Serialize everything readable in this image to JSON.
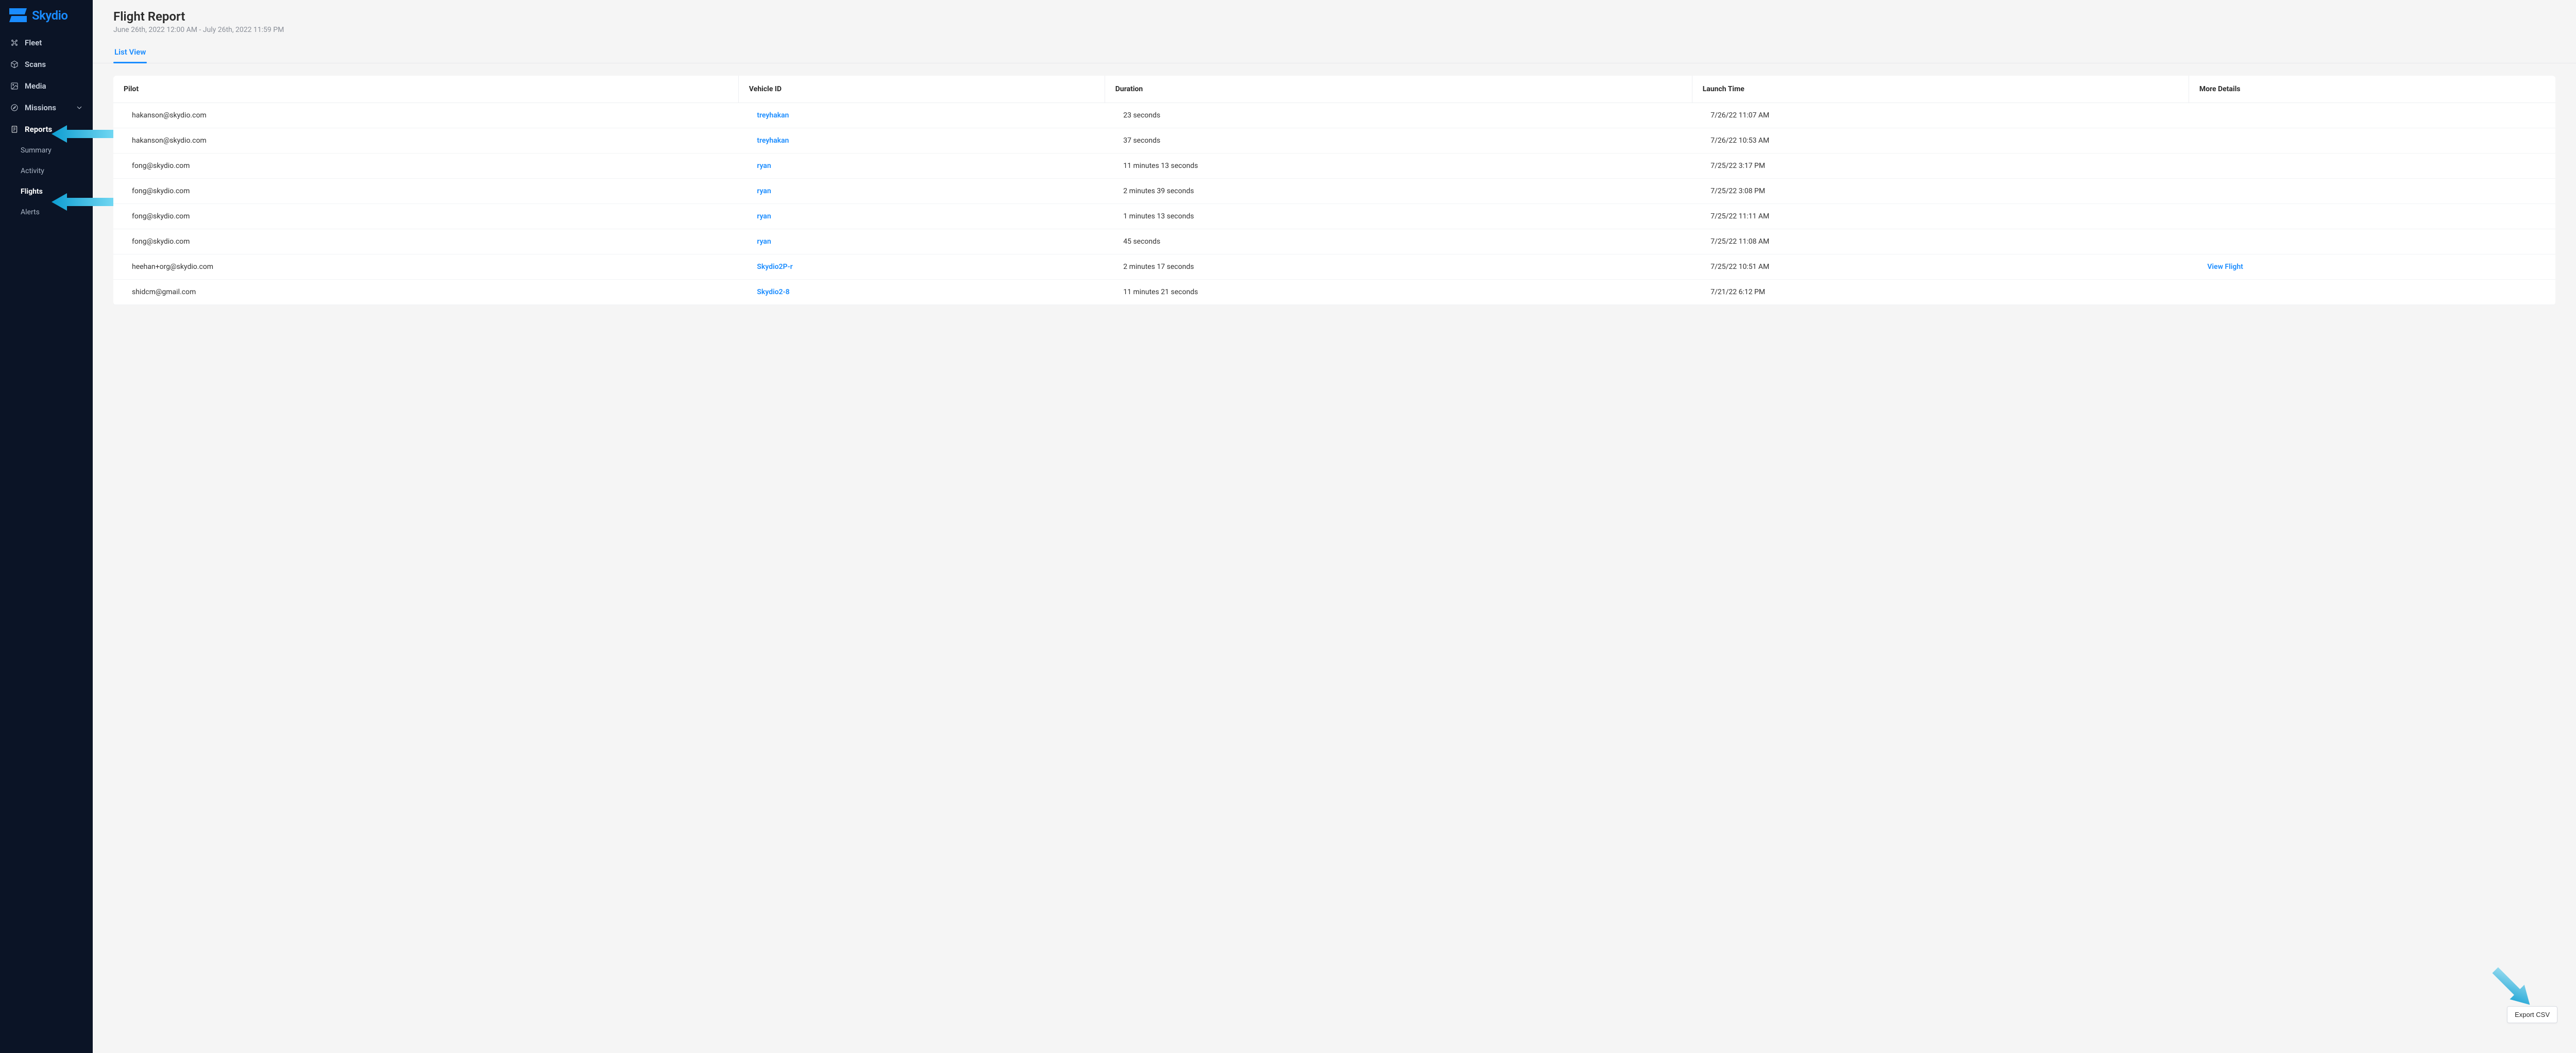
{
  "brand": {
    "name": "Skydio"
  },
  "sidebar": {
    "items": [
      {
        "label": "Fleet",
        "icon": "drone"
      },
      {
        "label": "Scans",
        "icon": "cube"
      },
      {
        "label": "Media",
        "icon": "image"
      },
      {
        "label": "Missions",
        "icon": "compass",
        "expandable": true
      },
      {
        "label": "Reports",
        "icon": "report",
        "active": true
      }
    ],
    "reports_sub": [
      {
        "label": "Summary"
      },
      {
        "label": "Activity"
      },
      {
        "label": "Flights",
        "active": true
      },
      {
        "label": "Alerts"
      }
    ]
  },
  "page": {
    "title": "Flight Report",
    "date_range": "June 26th, 2022 12:00 AM - July 26th, 2022 11:59 PM"
  },
  "tabs": {
    "list_view": "List View"
  },
  "table": {
    "headers": {
      "pilot": "Pilot",
      "vehicle": "Vehicle ID",
      "duration": "Duration",
      "launch": "Launch Time",
      "details": "More Details"
    },
    "rows": [
      {
        "pilot": "hakanson@skydio.com",
        "vehicle": "treyhakan",
        "duration": "23 seconds",
        "launch": "7/26/22 11:07 AM",
        "details": ""
      },
      {
        "pilot": "hakanson@skydio.com",
        "vehicle": "treyhakan",
        "duration": "37 seconds",
        "launch": "7/26/22 10:53 AM",
        "details": ""
      },
      {
        "pilot": "fong@skydio.com",
        "vehicle": "ryan",
        "duration": "11 minutes 13 seconds",
        "launch": "7/25/22 3:17 PM",
        "details": ""
      },
      {
        "pilot": "fong@skydio.com",
        "vehicle": "ryan",
        "duration": "2 minutes 39 seconds",
        "launch": "7/25/22 3:08 PM",
        "details": ""
      },
      {
        "pilot": "fong@skydio.com",
        "vehicle": "ryan",
        "duration": "1 minutes 13 seconds",
        "launch": "7/25/22 11:11 AM",
        "details": ""
      },
      {
        "pilot": "fong@skydio.com",
        "vehicle": "ryan",
        "duration": "45 seconds",
        "launch": "7/25/22 11:08 AM",
        "details": ""
      },
      {
        "pilot": "heehan+org@skydio.com",
        "vehicle": "Skydio2P-r",
        "duration": "2 minutes 17 seconds",
        "launch": "7/25/22 10:51 AM",
        "details": "View Flight"
      },
      {
        "pilot": "shidcm@gmail.com",
        "vehicle": "Skydio2-8",
        "duration": "11 minutes 21 seconds",
        "launch": "7/21/22 6:12 PM",
        "details": ""
      }
    ]
  },
  "buttons": {
    "export_csv": "Export CSV"
  },
  "colors": {
    "accent": "#1a8cff",
    "sidebar_bg": "#0b1426",
    "arrow": "#2ab6e6"
  }
}
